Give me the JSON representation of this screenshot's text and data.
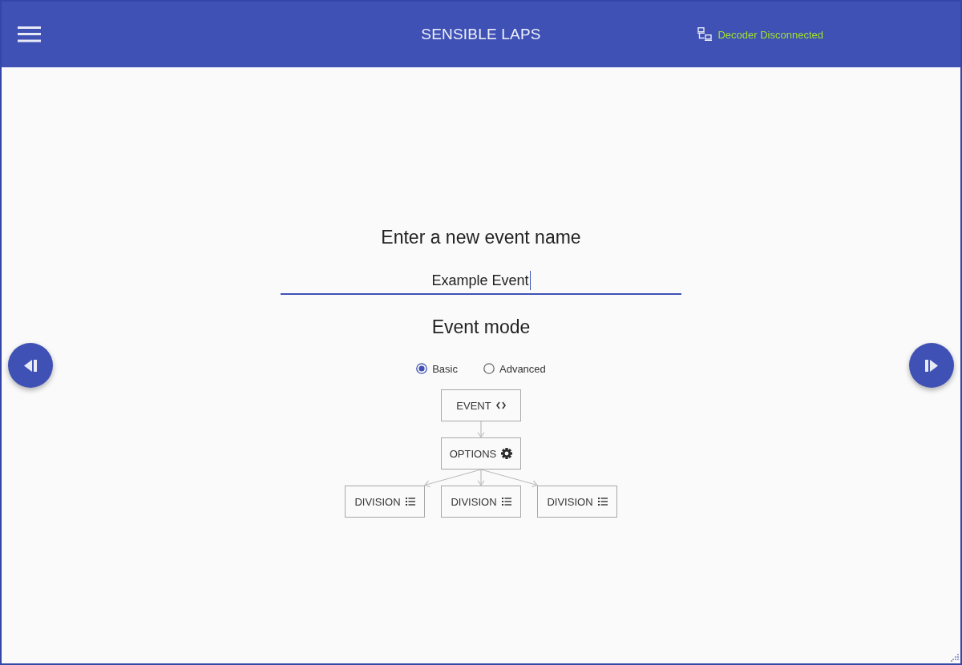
{
  "header": {
    "title": "SENSIBLE LAPS",
    "decoder_status": "Decoder Disconnected"
  },
  "form": {
    "heading": "Enter a new event name",
    "event_name": {
      "value": "Example Event",
      "focused": true
    },
    "mode_heading": "Event mode",
    "modes": [
      {
        "label": "Basic",
        "selected": true
      },
      {
        "label": "Advanced",
        "selected": false
      }
    ]
  },
  "structure": {
    "label": "EVENT",
    "kind": "event",
    "children": [
      {
        "label": "OPTIONS",
        "kind": "options",
        "children": [
          {
            "label": "DIVISION",
            "kind": "division"
          },
          {
            "label": "DIVISION",
            "kind": "division"
          },
          {
            "label": "DIVISION",
            "kind": "division"
          }
        ]
      }
    ]
  }
}
